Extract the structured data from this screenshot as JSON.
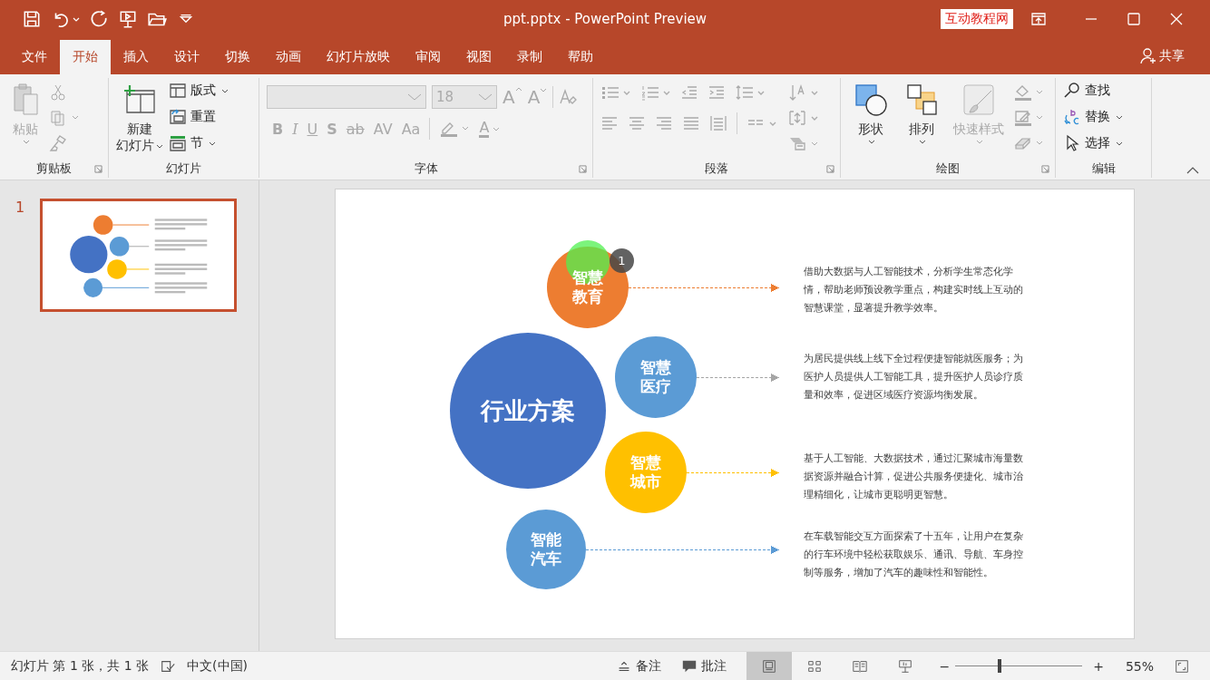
{
  "window": {
    "title": "ppt.pptx  -  PowerPoint Preview",
    "badge": "互动教程网"
  },
  "tabs": [
    {
      "label": "文件",
      "selected": false
    },
    {
      "label": "开始",
      "selected": true
    },
    {
      "label": "插入",
      "selected": false
    },
    {
      "label": "设计",
      "selected": false
    },
    {
      "label": "切换",
      "selected": false
    },
    {
      "label": "动画",
      "selected": false
    },
    {
      "label": "幻灯片放映",
      "selected": false
    },
    {
      "label": "审阅",
      "selected": false
    },
    {
      "label": "视图",
      "selected": false
    },
    {
      "label": "录制",
      "selected": false
    },
    {
      "label": "帮助",
      "selected": false
    }
  ],
  "share": "共享",
  "ribbon": {
    "clipboard": {
      "label": "剪贴板",
      "paste": {
        "label": "粘贴",
        "disabled": true
      }
    },
    "slides": {
      "label": "幻灯片",
      "new_slide": [
        "新建",
        "幻灯片"
      ],
      "layout": "版式",
      "reset": "重置",
      "section": "节"
    },
    "font": {
      "label": "字体",
      "font_size": "18",
      "grow": "A",
      "shrink": "A",
      "buttons": [
        "B",
        "I",
        "U",
        "S",
        "ab",
        "AV",
        "Aa"
      ],
      "color_button": "A",
      "disabled": true
    },
    "paragraph": {
      "label": "段落",
      "disabled": true
    },
    "drawing": {
      "label": "绘图",
      "shapes": "形状",
      "arrange": "排列",
      "quick_styles": {
        "label": "快速样式",
        "disabled": true
      }
    },
    "editing": {
      "label": "编辑",
      "find": "查找",
      "replace": "替换",
      "select": "选择"
    }
  },
  "slides": [
    {
      "number": "1",
      "selected": true
    }
  ],
  "slide": {
    "center": {
      "label": "行业方案",
      "color": "#4472c4"
    },
    "animation_marker": "1",
    "arrows": [
      {
        "color": "#ed7d31"
      },
      {
        "color": "#a5a5a5"
      },
      {
        "color": "#ffc000"
      },
      {
        "color": "#5b9bd5"
      }
    ],
    "branches": [
      {
        "label": "智慧教育",
        "color": "#ed7d31",
        "description": "借助大数据与人工智能技术，分析学生常态化学情，帮助老师预设教学重点，构建实时线上互动的智慧课堂，显著提升教学效率。"
      },
      {
        "label": "智慧医疗",
        "color": "#5b9bd5",
        "description": "为居民提供线上线下全过程便捷智能就医服务；为医护人员提供人工智能工具，提升医护人员诊疗质量和效率，促进区域医疗资源均衡发展。"
      },
      {
        "label": "智慧城市",
        "color": "#ffc000",
        "description": "基于人工智能、大数据技术，通过汇聚城市海量数据资源并融合计算，促进公共服务便捷化、城市治理精细化，让城市更聪明更智慧。"
      },
      {
        "label": "智能汽车",
        "color": "#5b9bd5",
        "description": "在车载智能交互方面探索了十五年，让用户在复杂的行车环境中轻松获取娱乐、通讯、导航、车身控制等服务，增加了汽车的趣味性和智能性。"
      }
    ]
  },
  "status_bar": {
    "slide_info": "幻灯片 第 1 张，共 1 张",
    "language": "中文(中国)",
    "notes": "备注",
    "comments": "批注",
    "views": [
      {
        "selected": true
      },
      {
        "selected": false
      },
      {
        "selected": false
      },
      {
        "selected": false
      }
    ],
    "zoom_out": "−",
    "zoom_in": "+",
    "zoom": {
      "level": 0.35
    },
    "zoom_text": "55%"
  }
}
